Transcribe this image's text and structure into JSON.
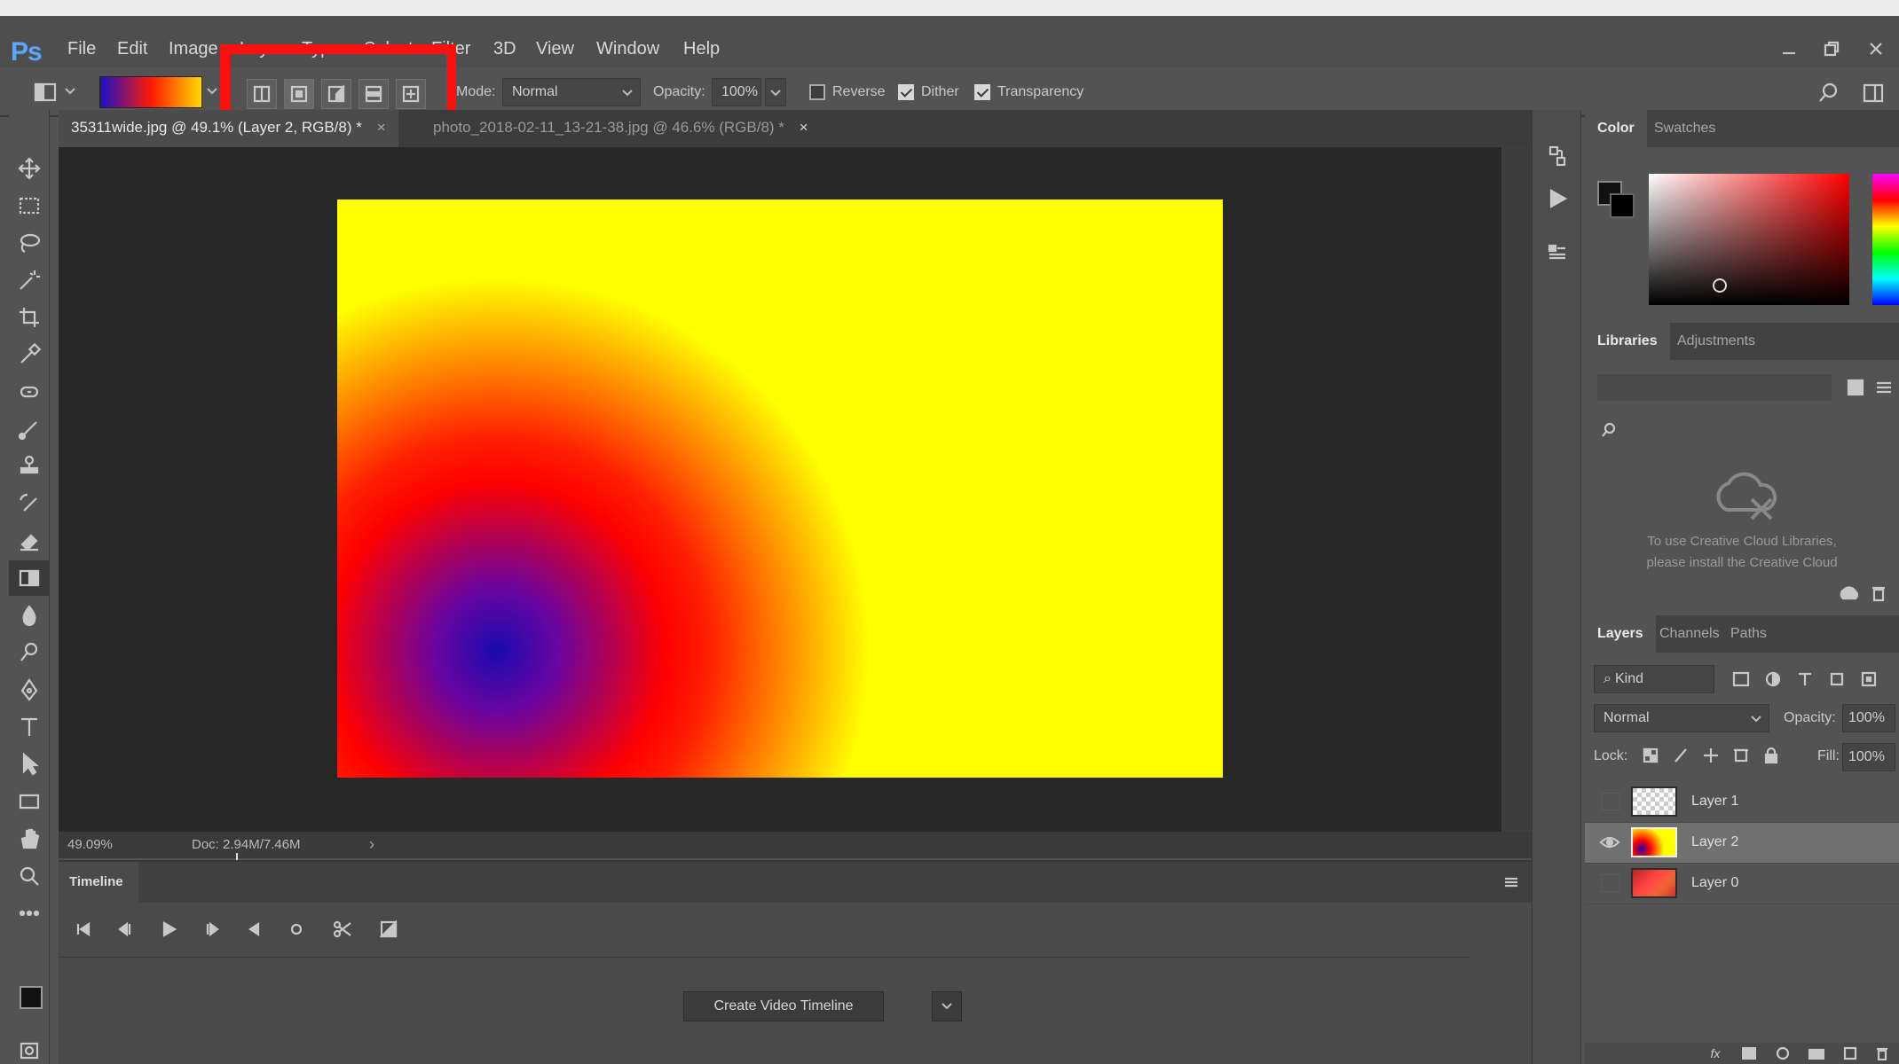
{
  "app": {
    "logo": "Ps"
  },
  "menu": {
    "items": [
      "File",
      "Edit",
      "Image",
      "Layer",
      "Type",
      "Select",
      "Filter",
      "3D",
      "View",
      "Window",
      "Help"
    ]
  },
  "options": {
    "mode_label": "Mode:",
    "mode_value": "Normal",
    "opacity_label": "Opacity:",
    "opacity_value": "100%",
    "reverse_label": "Reverse",
    "reverse_checked": false,
    "dither_label": "Dither",
    "dither_checked": true,
    "transparency_label": "Transparency",
    "transparency_checked": true,
    "gradient_types": [
      "linear-gradient",
      "radial-gradient",
      "angle-gradient",
      "reflected-gradient",
      "diamond-gradient"
    ],
    "highlight_color": "#ff1010"
  },
  "documents": {
    "tabs": [
      {
        "label": "35311wide.jpg @ 49.1% (Layer 2, RGB/8) *",
        "active": true
      },
      {
        "label": "photo_2018-02-11_13-21-38.jpg @ 46.6% (RGB/8) *",
        "active": false
      }
    ]
  },
  "canvas": {
    "gradient_colors": [
      "#1a0bb0",
      "#ff0000",
      "#ffff00"
    ]
  },
  "status": {
    "zoom": "49.09%",
    "doc": "Doc: 2.94M/7.46M"
  },
  "timeline": {
    "title": "Timeline",
    "create_button": "Create Video Timeline"
  },
  "color_panel": {
    "tabs": [
      "Color",
      "Swatches"
    ],
    "hue_color": "#ff0000"
  },
  "libraries_panel": {
    "tabs": [
      "Libraries",
      "Adjustments"
    ],
    "message_line1": "To use Creative Cloud Libraries,",
    "message_line2": "please install the Creative Cloud"
  },
  "layers_panel": {
    "tabs": [
      "Layers",
      "Channels",
      "Paths"
    ],
    "filter_label": "Kind",
    "blend_mode": "Normal",
    "opacity_label": "Opacity:",
    "opacity_value": "100%",
    "lock_label": "Lock:",
    "fill_label": "Fill:",
    "fill_value": "100%",
    "layers": [
      {
        "name": "Layer 1",
        "visible": false,
        "selected": false
      },
      {
        "name": "Layer 2",
        "visible": true,
        "selected": true
      },
      {
        "name": "Layer 0",
        "visible": false,
        "selected": false
      }
    ]
  }
}
